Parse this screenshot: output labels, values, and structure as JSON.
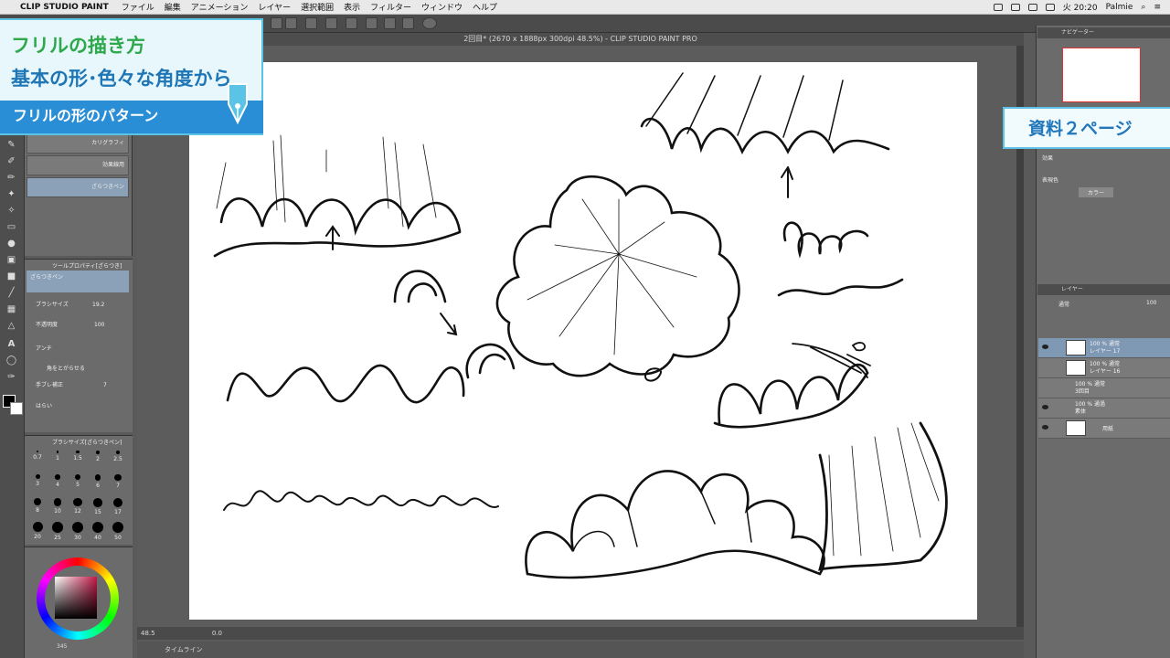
{
  "menubar": {
    "app_name": "CLIP STUDIO PAINT",
    "items": [
      "ファイル",
      "編集",
      "アニメーション",
      "レイヤー",
      "選択範囲",
      "表示",
      "フィルター",
      "ウィンドウ",
      "ヘルプ"
    ],
    "clock": "火 20:20",
    "user": "Palmie"
  },
  "document": {
    "title": "2回目* (2670 x 1888px 300dpi 48.5%) - CLIP STUDIO PAINT PRO",
    "zoom": "48.5",
    "angle": "0.0"
  },
  "overlay": {
    "title_line1": "フリルの描き方",
    "title_line2": "基本の形･色々な角度から",
    "subtitle": "フリルの形のパターン",
    "reference": "資料２ページ"
  },
  "subtool": {
    "brushes": [
      "カリグラフィ",
      "効果線用",
      "ざらつきペン"
    ]
  },
  "tool_property": {
    "header": "ツールプロパティ[ざらつき]",
    "brush_name": "ざらつきペン",
    "size_label": "ブラシサイズ",
    "size_value": "19.2",
    "opacity_label": "不透明度",
    "opacity_value": "100",
    "antialias_label": "アンチ",
    "sharpen_label": "角をとがらせる",
    "stabilize_label": "手ブレ補正",
    "stabilize_value": "7",
    "hairai_label": "はらい"
  },
  "brush_size": {
    "header": "ブラシサイズ[ざらつきペン]",
    "sizes": [
      "0.7",
      "1",
      "1.5",
      "2",
      "2.5",
      "3",
      "4",
      "5",
      "6",
      "7",
      "8",
      "10",
      "12",
      "15",
      "17",
      "20",
      "25",
      "30",
      "40",
      "50"
    ]
  },
  "navigator": {
    "tab": "ナビゲーター"
  },
  "properties": {
    "effect_label": "効果",
    "blend_label": "表現色",
    "blend_value": "カラー"
  },
  "layers": {
    "tab": "レイヤー",
    "blend_mode": "通常",
    "opacity": "100",
    "items": [
      {
        "line1": "100 % 通常",
        "line2": "レイヤー 17"
      },
      {
        "line1": "100 % 通常",
        "line2": "レイヤー 16"
      },
      {
        "line1": "100 % 通常",
        "line2": "3回目"
      },
      {
        "line1": "100 % 通過",
        "line2": "素体"
      },
      {
        "line1": "",
        "line2": "用紙"
      }
    ]
  },
  "timeline": {
    "label": "タイムライン"
  },
  "color": {
    "value": "345",
    "a": "0",
    "b": "0"
  },
  "colors": {
    "accent": "#2a8ed6",
    "title_green": "#2da84a",
    "title_blue": "#1e76b6"
  }
}
